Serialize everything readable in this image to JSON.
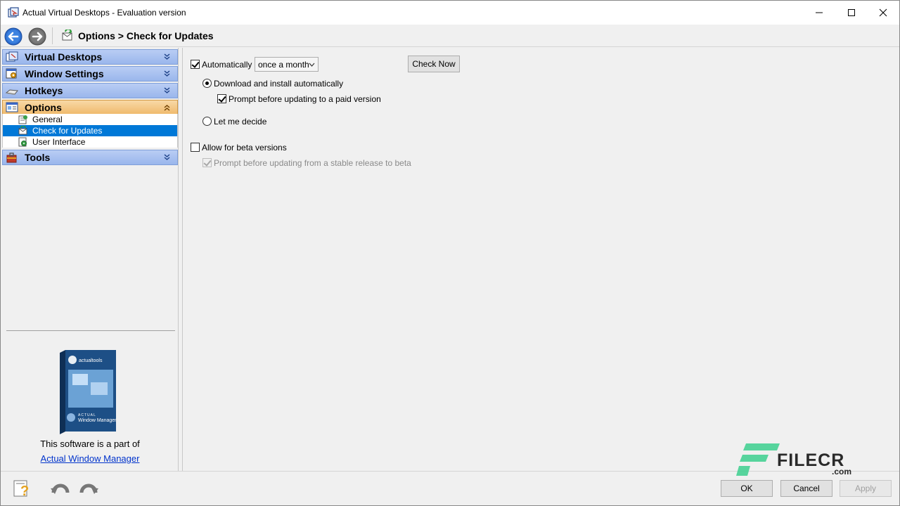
{
  "window": {
    "title": "Actual Virtual Desktops - Evaluation version"
  },
  "navbar": {
    "breadcrumb": "Options > Check for Updates"
  },
  "sidebar": {
    "groups": [
      {
        "label": "Virtual Desktops",
        "icon": "virtual-desktops-icon",
        "expanded": false
      },
      {
        "label": "Window Settings",
        "icon": "window-settings-icon",
        "expanded": false
      },
      {
        "label": "Hotkeys",
        "icon": "keyboard-icon",
        "expanded": false
      },
      {
        "label": "Options",
        "icon": "options-icon",
        "expanded": true
      },
      {
        "label": "Tools",
        "icon": "tools-icon",
        "expanded": false
      }
    ],
    "options_items": [
      {
        "label": "General",
        "icon": "general-settings-icon"
      },
      {
        "label": "Check for Updates",
        "icon": "update-icon",
        "selected": true
      },
      {
        "label": "User Interface",
        "icon": "user-interface-icon"
      }
    ],
    "part_of_text": "This software is a part of",
    "part_of_link": "Actual Window Manager",
    "product_box_brand": "actualtools",
    "product_box_line1": "ACTUAL",
    "product_box_line2": "Window Manager"
  },
  "updates": {
    "automatically_label": "Automatically",
    "automatically_checked": true,
    "frequency_value": "once a month",
    "check_now_label": "Check Now",
    "download_install_label": "Download and install automatically",
    "download_install_selected": true,
    "prompt_paid_label": "Prompt before updating to a paid version",
    "prompt_paid_checked": true,
    "let_me_decide_label": "Let me decide",
    "beta_label": "Allow for beta versions",
    "beta_checked": false,
    "prompt_beta_label": "Prompt before updating from a stable release to beta",
    "prompt_beta_checked": true
  },
  "footer": {
    "ok_label": "OK",
    "cancel_label": "Cancel",
    "apply_label": "Apply"
  },
  "watermark": {
    "text": "FILECR",
    "suffix": ".com"
  },
  "colors": {
    "selection": "#0078d7",
    "group_header": "#a8c2f0",
    "active_group_header": "#f3c582",
    "link": "#0033cc"
  }
}
